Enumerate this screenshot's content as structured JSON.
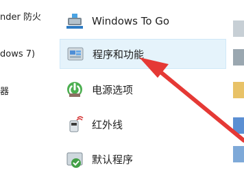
{
  "left_column": {
    "items": [
      {
        "label": "nder 防火"
      },
      {
        "label": "dows 7)"
      },
      {
        "label": "器"
      }
    ]
  },
  "main": {
    "items": [
      {
        "label": "Windows To Go",
        "icon": "usb-drive-icon"
      },
      {
        "label": "程序和功能",
        "icon": "programs-features-icon",
        "selected": true
      },
      {
        "label": "电源选项",
        "icon": "power-options-icon"
      },
      {
        "label": "红外线",
        "icon": "infrared-icon"
      },
      {
        "label": "默认程序",
        "icon": "default-programs-icon"
      }
    ]
  },
  "annotation": {
    "arrow_color": "#e53935"
  }
}
